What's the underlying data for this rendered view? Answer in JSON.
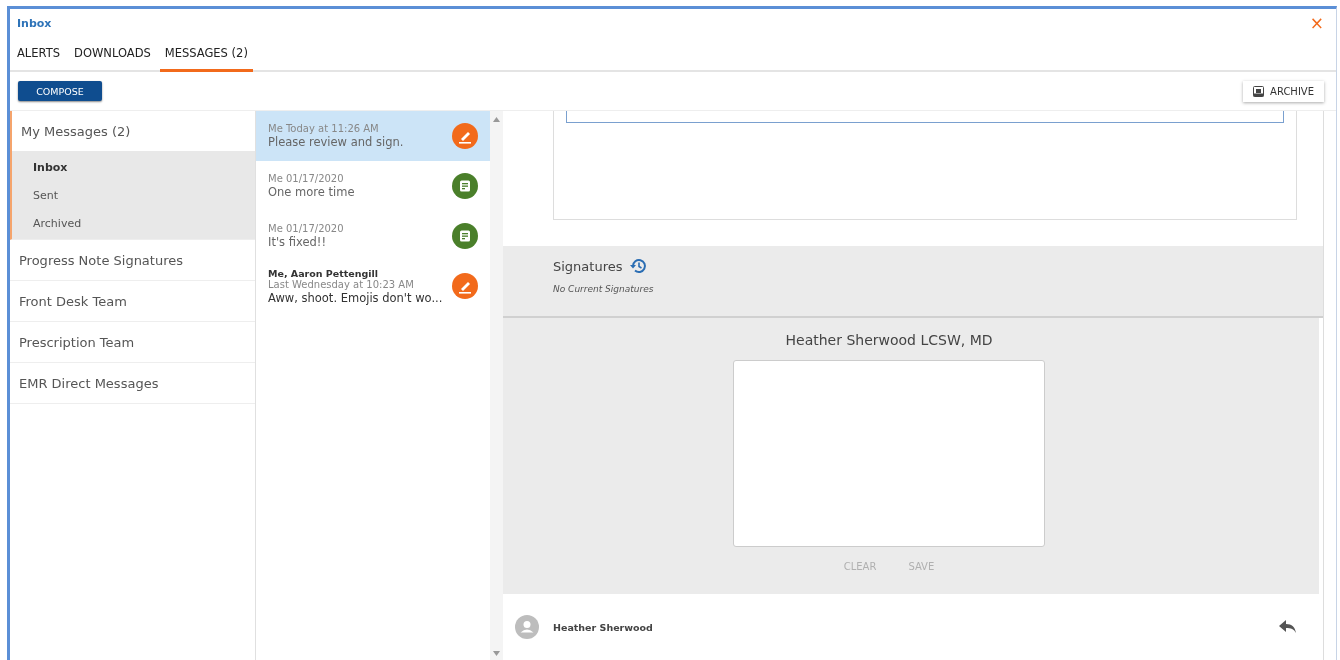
{
  "window": {
    "title": "Inbox",
    "close": "×"
  },
  "tabs": [
    {
      "label": "ALERTS",
      "selected": false
    },
    {
      "label": "DOWNLOADS",
      "selected": false
    },
    {
      "label": "MESSAGES (2)",
      "selected": true
    }
  ],
  "toolbar": {
    "compose": "COMPOSE",
    "archive": "ARCHIVE"
  },
  "sidebar": {
    "items": [
      {
        "label": "My Messages (2)",
        "expanded": true,
        "children": [
          {
            "label": "Inbox",
            "selected": true
          },
          {
            "label": "Sent",
            "selected": false
          },
          {
            "label": "Archived",
            "selected": false
          }
        ]
      },
      {
        "label": "Progress Note Signatures",
        "expanded": false
      },
      {
        "label": "Front Desk Team",
        "expanded": false
      },
      {
        "label": "Prescription Team",
        "expanded": false
      },
      {
        "label": "EMR Direct Messages",
        "expanded": false
      }
    ]
  },
  "messages": [
    {
      "time": "Me Today at 11:26 AM",
      "subject": "Please review and sign.",
      "kind": "sign",
      "selected": true
    },
    {
      "time": "Me 01/17/2020",
      "subject": "One more time",
      "kind": "note",
      "selected": false
    },
    {
      "time": "Me 01/17/2020",
      "subject": "It's fixed!!",
      "kind": "note",
      "selected": false
    },
    {
      "sender": "Me, Aaron Pettengill",
      "time": "Last Wednesday at 10:23 AM",
      "subject": "Aww, shoot. Emojis don't wo...",
      "kind": "sign",
      "selected": false
    }
  ],
  "signatures": {
    "title": "Signatures",
    "empty": "No Current Signatures"
  },
  "signature_pad": {
    "signer": "Heather Sherwood LCSW, MD",
    "clear": "CLEAR",
    "save": "SAVE",
    "disabled": true
  },
  "footer": {
    "author": "Heather Sherwood"
  }
}
